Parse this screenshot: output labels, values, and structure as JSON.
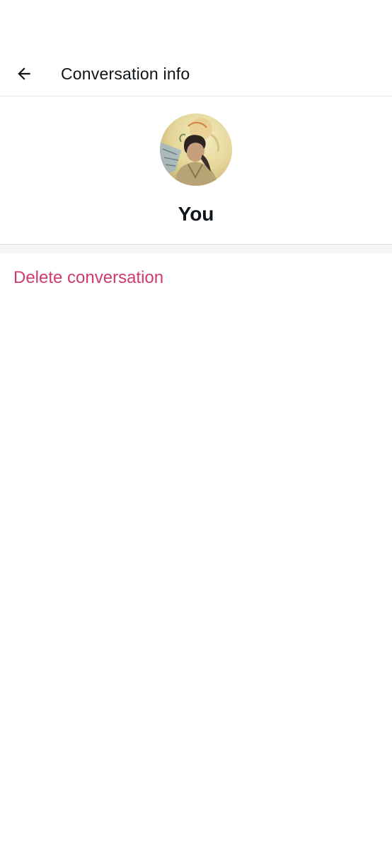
{
  "header": {
    "title": "Conversation info",
    "back_icon": "arrow-left-icon"
  },
  "profile": {
    "name": "You",
    "avatar_description": "profile-photo"
  },
  "actions": {
    "delete_label": "Delete conversation"
  },
  "colors": {
    "danger": "#d03c68",
    "text": "#0f1419",
    "divider": "#e6e6e6",
    "section_bg": "#f5f5f5"
  }
}
